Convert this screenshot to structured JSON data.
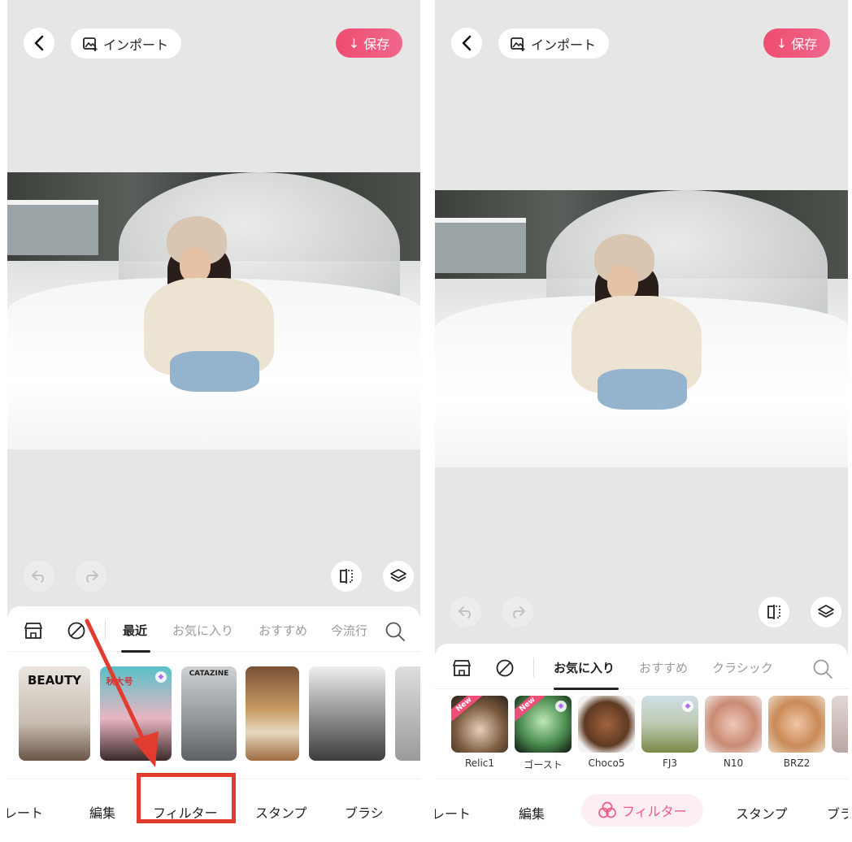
{
  "colors": {
    "accent": "#ef5a85",
    "save_gradient_start": "#ee4d6e",
    "save_gradient_end": "#f0678c",
    "annotation_red": "#e23b30",
    "canvas_bg": "#e6e6e6"
  },
  "left": {
    "header": {
      "back_icon": "chevron-left-icon",
      "import_label": "インポート",
      "save_label": "保存"
    },
    "tabs": [
      "最近",
      "お気に入り",
      "おすすめ",
      "今流行"
    ],
    "active_tab": "最近",
    "thumbnails": [
      {
        "name": "beauty",
        "text": "BEAUTY"
      },
      {
        "name": "magazine-red",
        "text": "秋大号"
      },
      {
        "name": "catazine",
        "text": "CATAZINE"
      },
      {
        "name": "food",
        "text": ""
      },
      {
        "name": "monochrome",
        "text": ""
      }
    ],
    "nav": [
      "レート",
      "編集",
      "フィルター",
      "スタンプ",
      "ブラシ"
    ]
  },
  "right": {
    "header": {
      "back_icon": "chevron-left-icon",
      "import_label": "インポート",
      "save_label": "保存"
    },
    "tabs": [
      "お気に入り",
      "おすすめ",
      "クラシック"
    ],
    "active_tab": "お気に入り",
    "filters": [
      {
        "label": "Relic1",
        "badge": "New"
      },
      {
        "label": "ゴースト",
        "badge": "New"
      },
      {
        "label": "Choco5",
        "badge": ""
      },
      {
        "label": "FJ3",
        "badge": ""
      },
      {
        "label": "N10",
        "badge": ""
      },
      {
        "label": "BRZ2",
        "badge": ""
      }
    ],
    "nav": [
      "レート",
      "編集",
      "フィルター",
      "スタンプ",
      "ブラ"
    ]
  }
}
